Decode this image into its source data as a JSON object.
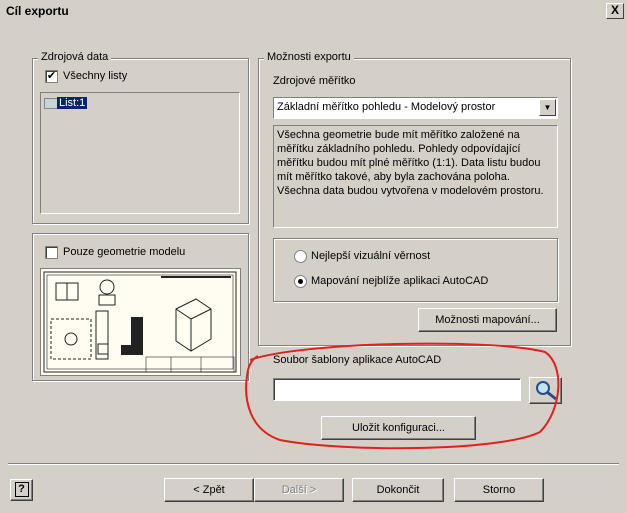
{
  "window": {
    "title": "Cíl exportu",
    "close_label": "X"
  },
  "source_data": {
    "group_label": "Zdrojová data",
    "all_sheets_label": "Všechny listy",
    "all_sheets_checked": true,
    "sheets": [
      "List:1"
    ]
  },
  "model_only": {
    "label": "Pouze geometrie modelu",
    "checked": false
  },
  "export_options": {
    "group_label": "Možnosti exportu",
    "scale_label": "Zdrojové měřítko",
    "scale_value": "Základní měřítko pohledu - Modelový prostor",
    "description": "Všechna geometrie bude mít měřítko založené na měřítku základního pohledu. Pohledy odpovídající měřítku budou mít plné měřítko (1:1). Data listu budou mít měřítko takové, aby byla zachována poloha. Všechna data budou vytvořena v modelovém prostoru.",
    "radio_best": "Nejlepší vizuální věrnost",
    "radio_mapping": "Mapování nejblíže aplikaci AutoCAD",
    "selected": "mapping",
    "mapping_button": "Možnosti mapování...",
    "template_label": "Soubor šablony aplikace AutoCAD",
    "template_value": "",
    "save_config_button": "Uložit konfiguraci..."
  },
  "footer": {
    "back": "< Zpět",
    "next": "Další >",
    "finish": "Dokončit",
    "cancel": "Storno",
    "help": "?"
  },
  "colors": {
    "annotation_circle": "#e02020",
    "selection": "#0a246a"
  }
}
